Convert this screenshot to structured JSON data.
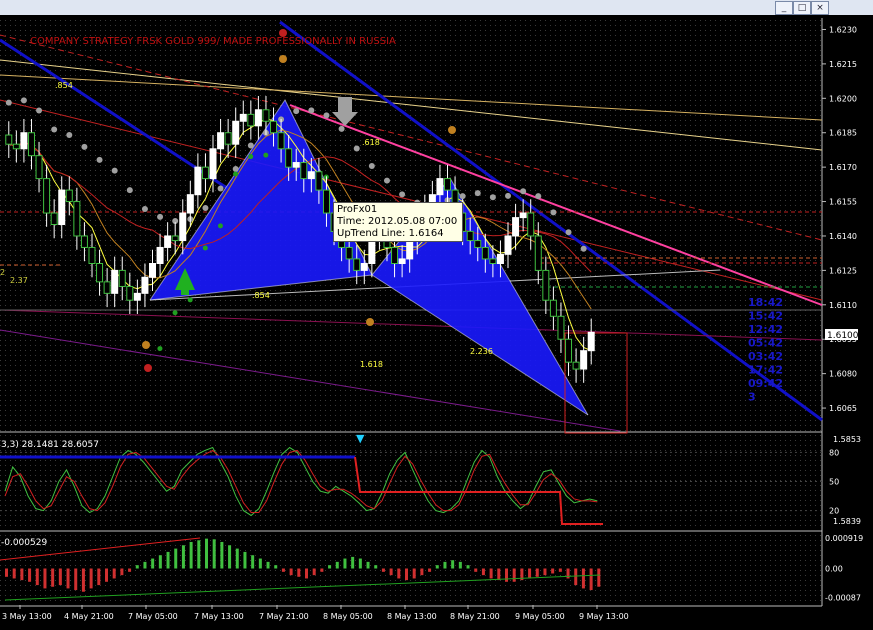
{
  "window": {
    "buttons": [
      "_",
      "□",
      "×"
    ]
  },
  "watermark": "COMPANY STRATEGY FRSK GOLD 999/ MADE PROFESSIONALLY IN RUSSIA",
  "tooltip": {
    "name": "ProFx01",
    "time": "Time: 2012.05.08 07:00",
    "line": "UpTrend Line: 1.6164"
  },
  "price_badge": "1.6100",
  "chart_data": [
    {
      "type": "candlestick",
      "panel": "price",
      "ylim": [
        1.6055,
        1.6235
      ],
      "yticks": [
        "1.6230",
        "1.6215",
        "1.6200",
        "1.6185",
        "1.6170",
        "1.6155",
        "1.6140",
        "1.6125",
        "1.6110",
        "1.6095",
        "1.6080",
        "1.6065"
      ],
      "current_price": 1.61,
      "close": [
        1.618,
        1.6178,
        1.6185,
        1.6175,
        1.6165,
        1.615,
        1.6145,
        1.616,
        1.6155,
        1.614,
        1.6135,
        1.6128,
        1.612,
        1.6115,
        1.6125,
        1.6118,
        1.6112,
        1.6115,
        1.6122,
        1.6128,
        1.6135,
        1.614,
        1.6138,
        1.615,
        1.6158,
        1.617,
        1.6165,
        1.6178,
        1.6185,
        1.618,
        1.619,
        1.6193,
        1.6188,
        1.6195,
        1.619,
        1.6185,
        1.6178,
        1.617,
        1.6172,
        1.6165,
        1.6168,
        1.616,
        1.615,
        1.6142,
        1.6135,
        1.613,
        1.6125,
        1.6128,
        1.614,
        1.6145,
        1.6135,
        1.6128,
        1.613,
        1.6138,
        1.6145,
        1.6152,
        1.6158,
        1.6165,
        1.616,
        1.615,
        1.6142,
        1.6138,
        1.6135,
        1.613,
        1.6128,
        1.6132,
        1.614,
        1.6148,
        1.615,
        1.614,
        1.6125,
        1.6112,
        1.6105,
        1.6095,
        1.6085,
        1.6082,
        1.609,
        1.6098
      ],
      "fibo_labels": [
        ".854",
        ".854",
        ".618",
        "1.618",
        "2.236"
      ],
      "pattern_numbers": [
        "18:42",
        "15:42",
        "12:42",
        "05:42",
        "03:42",
        "17:42",
        "09:42",
        "3"
      ],
      "right_labels": [
        "2",
        "2.37"
      ]
    },
    {
      "type": "line",
      "panel": "stochastic",
      "title": "3,3) 28.1481 28.6057",
      "ylim": [
        0,
        100
      ],
      "yticks": [
        "80",
        "50",
        "20"
      ],
      "side_values": [
        "1.5853",
        "1.5839"
      ],
      "series": [
        {
          "values": [
            40,
            65,
            55,
            35,
            22,
            20,
            30,
            50,
            62,
            45,
            25,
            18,
            22,
            35,
            55,
            75,
            82,
            78,
            70,
            60,
            50,
            40,
            45,
            62,
            70,
            78,
            82,
            85,
            70,
            55,
            35,
            20,
            15,
            22,
            40,
            60,
            78,
            85,
            80,
            65,
            50,
            40,
            38,
            45,
            40,
            35,
            28,
            20,
            22,
            38,
            58,
            72,
            80,
            62,
            45,
            30,
            20,
            18,
            22,
            30,
            50,
            70,
            82,
            75,
            55,
            40,
            30,
            22,
            28,
            45,
            60,
            62,
            48,
            35,
            28,
            30,
            32,
            30
          ]
        },
        {
          "values": [
            35,
            55,
            58,
            45,
            30,
            22,
            25,
            40,
            55,
            50,
            35,
            22,
            20,
            28,
            45,
            65,
            78,
            80,
            75,
            65,
            55,
            45,
            42,
            55,
            65,
            72,
            78,
            82,
            75,
            62,
            45,
            28,
            18,
            18,
            30,
            50,
            68,
            80,
            82,
            72,
            58,
            45,
            40,
            42,
            42,
            38,
            32,
            25,
            22,
            30,
            48,
            65,
            76,
            68,
            52,
            38,
            26,
            20,
            20,
            26,
            42,
            62,
            76,
            78,
            62,
            48,
            36,
            26,
            26,
            38,
            52,
            58,
            52,
            40,
            32,
            30,
            30,
            29
          ]
        }
      ]
    },
    {
      "type": "bar",
      "panel": "macd",
      "title": "-0.000529",
      "ylim": [
        -0.0011,
        0.0011
      ],
      "yticks": [
        "0.000919",
        "0.00",
        "-0.00087"
      ],
      "values": [
        -0.00025,
        -0.0003,
        -0.00035,
        -0.0004,
        -0.0005,
        -0.0006,
        -0.00055,
        -0.0005,
        -0.0006,
        -0.00065,
        -0.0007,
        -0.0006,
        -0.0005,
        -0.0004,
        -0.0003,
        -0.0002,
        -0.0001,
        0.0001,
        0.0002,
        0.0003,
        0.0004,
        0.0005,
        0.0006,
        0.0007,
        0.0008,
        0.00085,
        0.0009,
        0.00088,
        0.0008,
        0.0007,
        0.0006,
        0.0005,
        0.0004,
        0.0003,
        0.0002,
        0.0001,
        -0.0001,
        -0.0002,
        -0.00025,
        -0.0003,
        -0.0002,
        -0.0001,
        0.0001,
        0.0002,
        0.0003,
        0.00035,
        0.0003,
        0.0002,
        0.0001,
        -0.0001,
        -0.0002,
        -0.0003,
        -0.00035,
        -0.0003,
        -0.0002,
        -0.0001,
        0.0001,
        0.0002,
        0.00025,
        0.0002,
        0.0001,
        -0.0001,
        -0.0002,
        -0.0003,
        -0.00035,
        -0.0004,
        -0.0004,
        -0.00035,
        -0.0003,
        -0.00025,
        -0.0002,
        -0.00015,
        -0.0001,
        -0.0003,
        -0.0005,
        -0.0006,
        -0.00065,
        -0.00055
      ]
    }
  ],
  "xaxis": {
    "labels": [
      "3 May 13:00",
      "4 May 21:00",
      "7 May 05:00",
      "7 May 13:00",
      "7 May 21:00",
      "8 May 05:00",
      "8 May 13:00",
      "8 May 21:00",
      "9 May 05:00",
      "9 May 13:00"
    ]
  }
}
